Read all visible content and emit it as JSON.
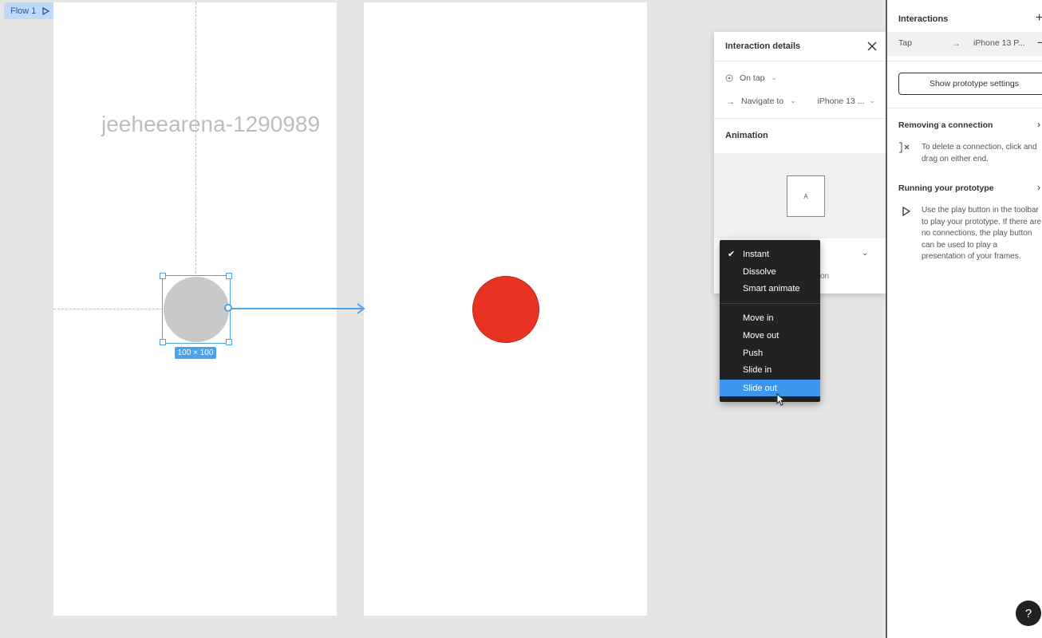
{
  "canvas": {
    "flow_label": "Flow 1",
    "watermark": "jeeheearena-1290989",
    "size_label": "100 × 100"
  },
  "details": {
    "title": "Interaction details",
    "trigger": "On tap",
    "action": "Navigate to",
    "destination": "iPhone 13 ...",
    "animation_label": "Animation",
    "preview_letter": "A",
    "hidden_text_fragment": "on"
  },
  "dropdown": {
    "selected": "Slide out",
    "checked": "Instant",
    "group1": [
      "Instant",
      "Dissolve",
      "Smart animate"
    ],
    "group2": [
      "Move in",
      "Move out",
      "Push",
      "Slide in",
      "Slide out"
    ]
  },
  "sidebar": {
    "title": "Interactions",
    "interaction": {
      "trigger": "Tap",
      "destination": "iPhone 13 P..."
    },
    "prototype_button": "Show prototype settings",
    "tips": [
      {
        "heading": "Removing a connection",
        "text": "To delete a connection, click and drag on either end."
      },
      {
        "heading": "Running your prototype",
        "text": "Use the play button in the toolbar to play your prototype. If there are no connections, the play button can be used to play a presentation of your frames."
      }
    ],
    "help": "?"
  },
  "colors": {
    "accent": "#4aa3ec",
    "selected_item": "#3c96ee",
    "red_circle": "#e83322",
    "gray_circle": "#c9c9c9"
  }
}
